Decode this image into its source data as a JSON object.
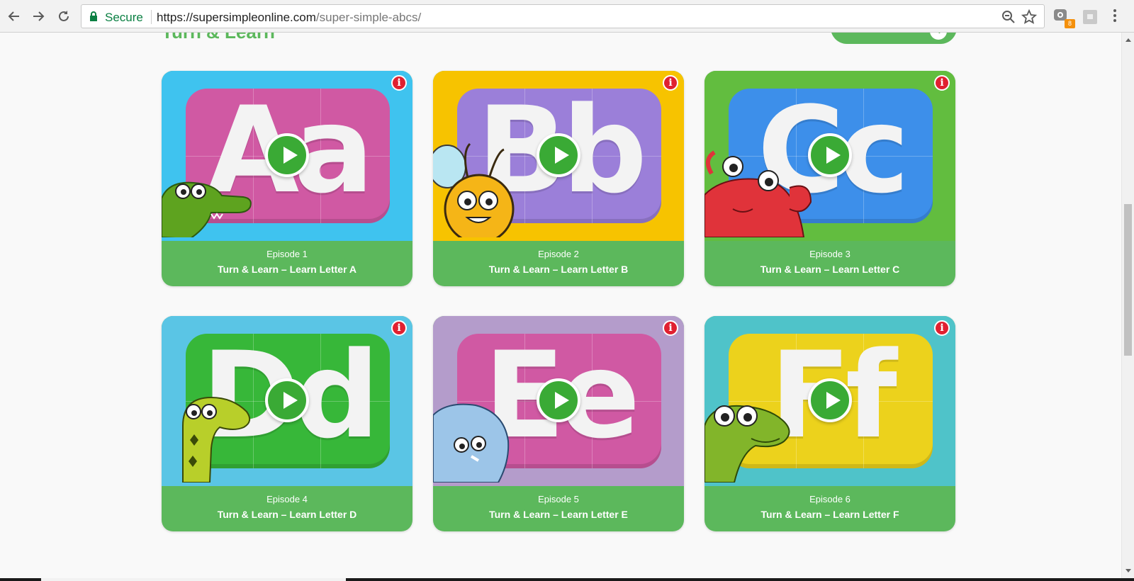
{
  "browser": {
    "secure_label": "Secure",
    "url_host": "https://supersimpleonline.com",
    "url_path": "/super-simple-abcs/",
    "extension_badge": "8"
  },
  "section": {
    "title": "Turn & Learn"
  },
  "episodes": [
    {
      "episode": "Episode 1",
      "title": "Turn & Learn – Learn Letter A",
      "letters": "Aa",
      "bg": "#3fc3ef",
      "board": "#d059a3",
      "mascot": "crocodile-icon"
    },
    {
      "episode": "Episode 2",
      "title": "Turn & Learn – Learn Letter B",
      "letters": "Bb",
      "bg": "#f7c300",
      "board": "#9b7fd9",
      "mascot": "bee-icon"
    },
    {
      "episode": "Episode 3",
      "title": "Turn & Learn – Learn Letter C",
      "letters": "Cc",
      "bg": "#62bd3f",
      "board": "#3d8fea",
      "mascot": "crab-icon"
    },
    {
      "episode": "Episode 4",
      "title": "Turn & Learn – Learn Letter D",
      "letters": "Dd",
      "bg": "#5ac5e5",
      "board": "#37b739",
      "mascot": "snake-icon"
    },
    {
      "episode": "Episode 5",
      "title": "Turn & Learn – Learn Letter E",
      "letters": "Ee",
      "bg": "#b49ccb",
      "board": "#d059a3",
      "mascot": "elephant-icon"
    },
    {
      "episode": "Episode 6",
      "title": "Turn & Learn – Learn Letter F",
      "letters": "Ff",
      "bg": "#4fc3c9",
      "board": "#ecd21c",
      "mascot": "frog-icon"
    }
  ],
  "colors": {
    "accent_green": "#5cb85c",
    "play_green": "#3aaa35",
    "info_red": "#e02030"
  }
}
